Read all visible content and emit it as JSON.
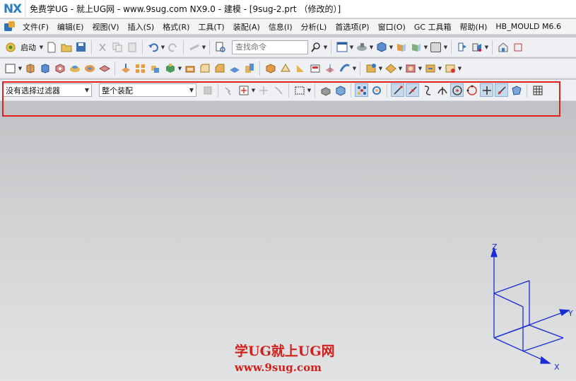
{
  "title_bar": {
    "logo": "NX",
    "title": "免费学UG - 就上UG网 - www.9sug.com NX9.0 - 建模 - [9sug-2.prt （修改的）]"
  },
  "menu": {
    "items": [
      "文件(F)",
      "编辑(E)",
      "视图(V)",
      "插入(S)",
      "格式(R)",
      "工具(T)",
      "装配(A)",
      "信息(I)",
      "分析(L)",
      "首选项(P)",
      "窗口(O)",
      "GC 工具箱",
      "帮助(H)",
      "HB_MOULD M6.6"
    ]
  },
  "toolbar_standard": {
    "start_label": "启动",
    "search_placeholder": "查找命令"
  },
  "selection_bar": {
    "type_filter": "没有选择过滤器",
    "scope": "整个装配"
  },
  "viewport": {
    "axes": {
      "x": "X",
      "y": "Y",
      "z": "Z"
    },
    "watermark_line1": "学UG就上UG网",
    "watermark_line2": "www.9sug.com"
  },
  "colors": {
    "highlight": "#e01f1f",
    "axis": "#1a2bd8",
    "logo": "#2a7fc0",
    "watermark": "#d4201b"
  }
}
